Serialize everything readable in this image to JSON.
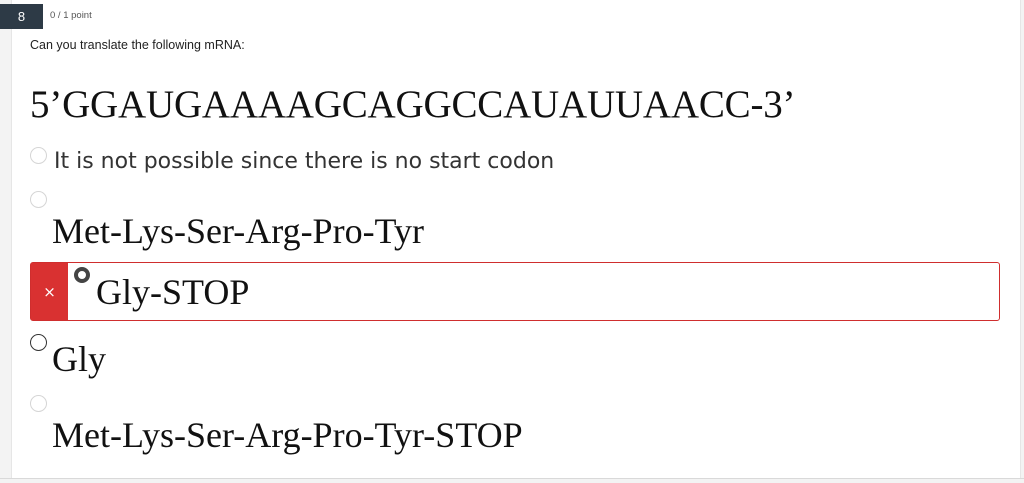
{
  "question": {
    "number": "8",
    "points": "0 / 1 point",
    "prompt": "Can you translate the following mRNA:",
    "sequence": "5’GGAUGAAAAGCAGGCCAUAUUAACC-3’"
  },
  "options": [
    {
      "label": "It is not possible since there is no start codon",
      "selected": false
    },
    {
      "label": "Met-Lys-Ser-Arg-Pro-Tyr",
      "selected": false
    },
    {
      "label": "Gly-STOP",
      "selected": true,
      "result": "incorrect"
    },
    {
      "label": "Gly",
      "selected": false
    },
    {
      "label": "Met-Lys-Ser-Arg-Pro-Tyr-STOP",
      "selected": false
    }
  ],
  "feedback": {
    "incorrect_icon": "close-icon",
    "incorrect_symbol": "×",
    "incorrect_color": "#d93131"
  }
}
